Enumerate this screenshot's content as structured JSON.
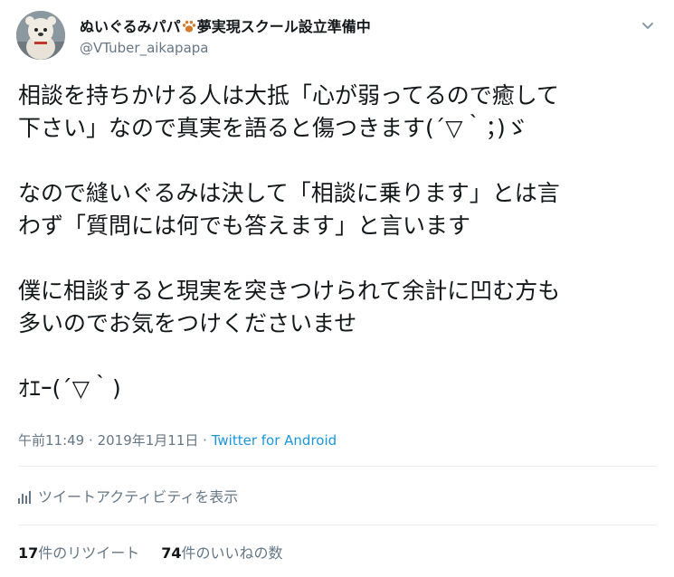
{
  "author": {
    "name_before_icon": "ぬいぐるみパパ",
    "name_after_icon": "夢実現スクール設立準備中",
    "handle": "@VTuber_aikapapa",
    "name_icon": "paw-print-icon"
  },
  "tweet": {
    "lines": [
      "相談を持ちかける人は大抵「心が弱ってるので癒して",
      "下さい」なので真実を語ると傷つきます(´▽｀；)ゞ",
      "なので縫いぐるみは決して「相談に乗ります」とは言",
      "わず「質問には何でも答えます」と言います",
      "僕に相談すると現実を突きつけられて余計に凹む方も",
      "多いのでお気をつけくださいませ",
      "ｵｴｰ(´▽｀)"
    ]
  },
  "meta": {
    "time": "午前11:49",
    "separator": "·",
    "date": "2019年1月11日",
    "source": "Twitter for Android"
  },
  "activity_link": "ツイートアクティビティを表示",
  "stats": {
    "retweets_count": "17",
    "retweets_label": "件のリツイート",
    "likes_count": "74",
    "likes_label": "件のいいねの数"
  },
  "colors": {
    "text": "#14171a",
    "secondary": "#657786",
    "link": "#1b95e0",
    "paw": "#d77a28"
  }
}
